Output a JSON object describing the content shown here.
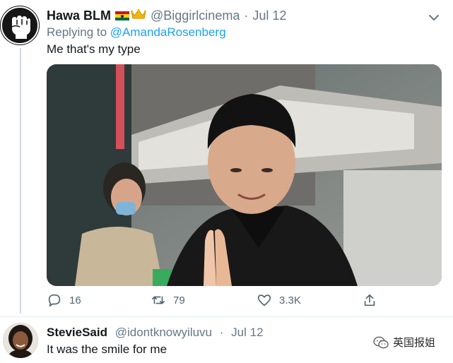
{
  "tweet1": {
    "display_name": "Hawa BLM",
    "flag_icon": "ghana-flag-icon",
    "crown_icon": "crown-icon",
    "handle": "@Biggirlcinema",
    "separator": "·",
    "date": "Jul 12",
    "replying_prefix": "Replying to",
    "replying_to": "@AmandaRosenberg",
    "text": "Me that's my type",
    "media_icon": "video-thumbnail",
    "actions": {
      "reply_count": "16",
      "retweet_count": "79",
      "like_count": "3.3K"
    }
  },
  "tweet2": {
    "display_name": "StevieSaid",
    "handle": "@idontknowyiluvu",
    "separator": "·",
    "date": "Jul 12",
    "text": "It was the smile for me"
  },
  "watermark": {
    "label": "英国报姐",
    "icon": "wechat-icon"
  },
  "colors": {
    "link": "#1da1f2",
    "secondary_text": "#657786",
    "thread_line": "#cfd9de",
    "divider": "#e6ecf0"
  }
}
